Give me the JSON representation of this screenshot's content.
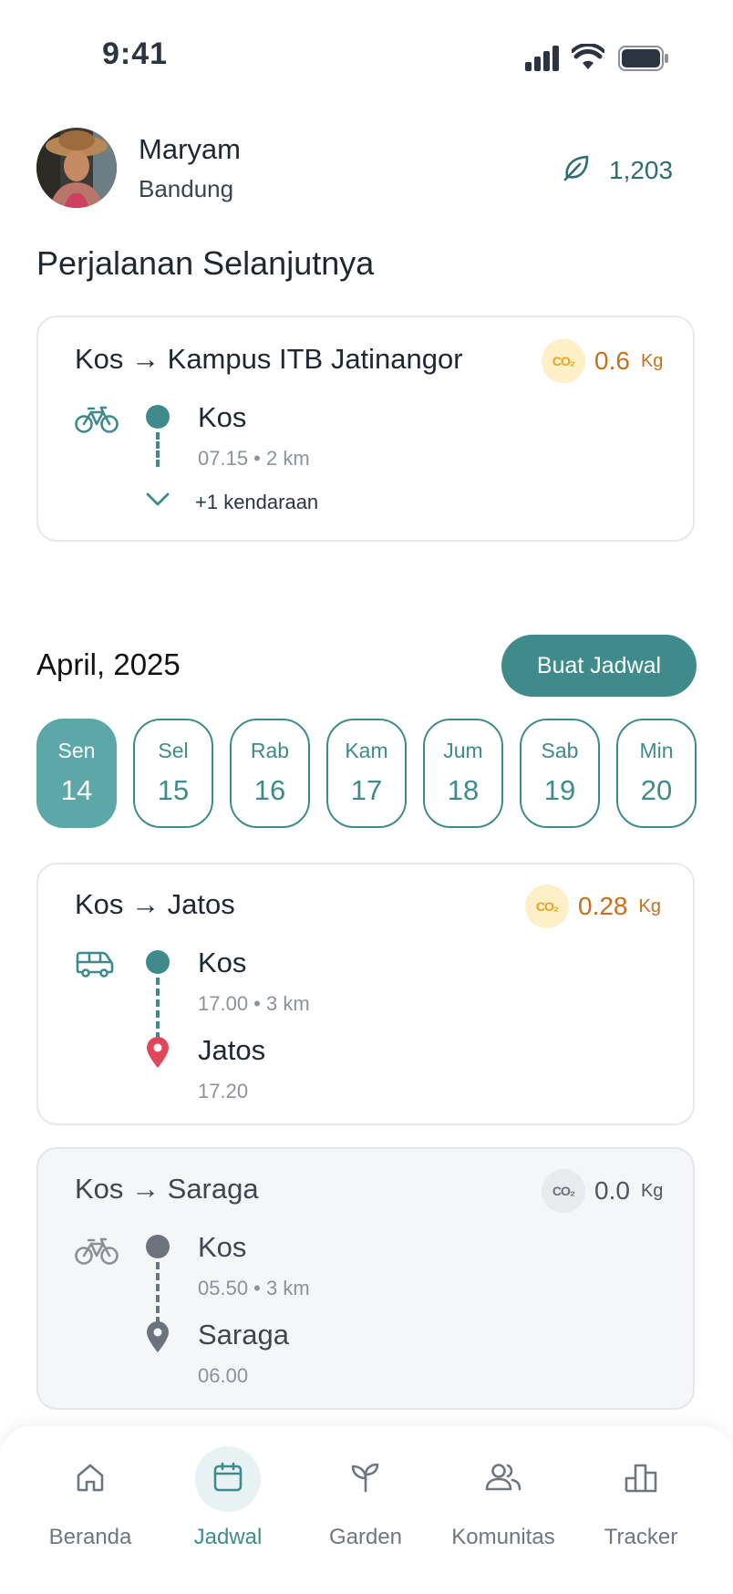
{
  "status_bar": {
    "time": "9:41"
  },
  "user": {
    "name": "Maryam",
    "city": "Bandung",
    "points": "1,203"
  },
  "next_trip": {
    "section_title": "Perjalanan Selanjutnya",
    "title": "Kos → Kampus ITB Jatinangor",
    "co2_label": "CO₂",
    "co2_value": "0.6",
    "co2_unit": "Kg",
    "vehicle_icon": "bicycle-icon",
    "stop_name": "Kos",
    "stop_meta": "07.15 • 2 km",
    "more_vehicles": "+1 kendaraan"
  },
  "calendar": {
    "month": "April, 2025",
    "create_button": "Buat Jadwal",
    "days": [
      {
        "name": "Sen",
        "num": "14",
        "active": true
      },
      {
        "name": "Sel",
        "num": "15"
      },
      {
        "name": "Rab",
        "num": "16"
      },
      {
        "name": "Kam",
        "num": "17"
      },
      {
        "name": "Jum",
        "num": "18"
      },
      {
        "name": "Sab",
        "num": "19"
      },
      {
        "name": "Min",
        "num": "20"
      }
    ]
  },
  "trips": [
    {
      "title": "Kos → Jatos",
      "co2_label": "CO₂",
      "co2_value": "0.28",
      "co2_unit": "Kg",
      "vehicle_icon": "van-icon",
      "from": "Kos",
      "from_meta": "17.00 • 3 km",
      "to": "Jatos",
      "to_meta": "17.20"
    },
    {
      "title": "Kos → Saraga",
      "co2_label": "CO₂",
      "co2_value": "0.0",
      "co2_unit": "Kg",
      "vehicle_icon": "bicycle-icon",
      "from": "Kos",
      "from_meta": "05.50 • 3 km",
      "to": "Saraga",
      "to_meta": "06.00"
    }
  ],
  "nav": {
    "items": [
      {
        "label": "Beranda",
        "icon": "home-icon"
      },
      {
        "label": "Jadwal",
        "icon": "calendar-icon",
        "active": true
      },
      {
        "label": "Garden",
        "icon": "sprout-icon"
      },
      {
        "label": "Komunitas",
        "icon": "users-icon"
      },
      {
        "label": "Tracker",
        "icon": "bar-chart-icon"
      }
    ]
  },
  "colors": {
    "accent": "#3f8b8c",
    "co2_orange": "#c5701c",
    "pin_red": "#e0475b"
  }
}
